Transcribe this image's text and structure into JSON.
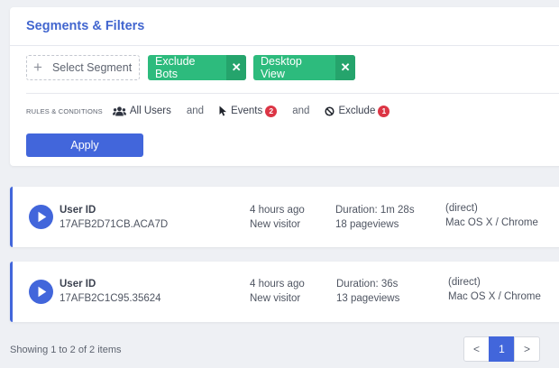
{
  "filters": {
    "title": "Segments & Filters",
    "select_segment_label": "Select Segment",
    "chips": [
      {
        "label": "Exclude Bots",
        "remove": "✕"
      },
      {
        "label": "Desktop View",
        "remove": "✕"
      }
    ],
    "rules_label": "RULES & CONDITIONS",
    "conj": "and",
    "rules": [
      {
        "label": "All Users",
        "icon": "users-icon"
      },
      {
        "label": "Events",
        "icon": "cursor-icon",
        "badge": "2"
      },
      {
        "label": "Exclude",
        "icon": "ban-icon",
        "badge": "1"
      }
    ],
    "apply_label": "Apply"
  },
  "sessions": [
    {
      "user_label": "User ID",
      "user_id": "17AFB2D71CB.ACA7D",
      "time": "4 hours ago",
      "visitor": "New visitor",
      "duration": "Duration: 1m 28s",
      "pageviews": "18 pageviews",
      "source": "(direct)",
      "platform": "Mac OS X / Chrome"
    },
    {
      "user_label": "User ID",
      "user_id": "17AFB2C1C95.35624",
      "time": "4 hours ago",
      "visitor": "New visitor",
      "duration": "Duration: 36s",
      "pageviews": "13 pageviews",
      "source": "(direct)",
      "platform": "Mac OS X / Chrome"
    }
  ],
  "footer": {
    "showing": "Showing 1 to 2 of 2 items",
    "prev": "<",
    "page": "1",
    "next": ">"
  },
  "colors": {
    "accent": "#4266db",
    "chip_green": "#2dbb7d",
    "badge_red": "#dc3545",
    "title_blue": "#4266cf"
  }
}
